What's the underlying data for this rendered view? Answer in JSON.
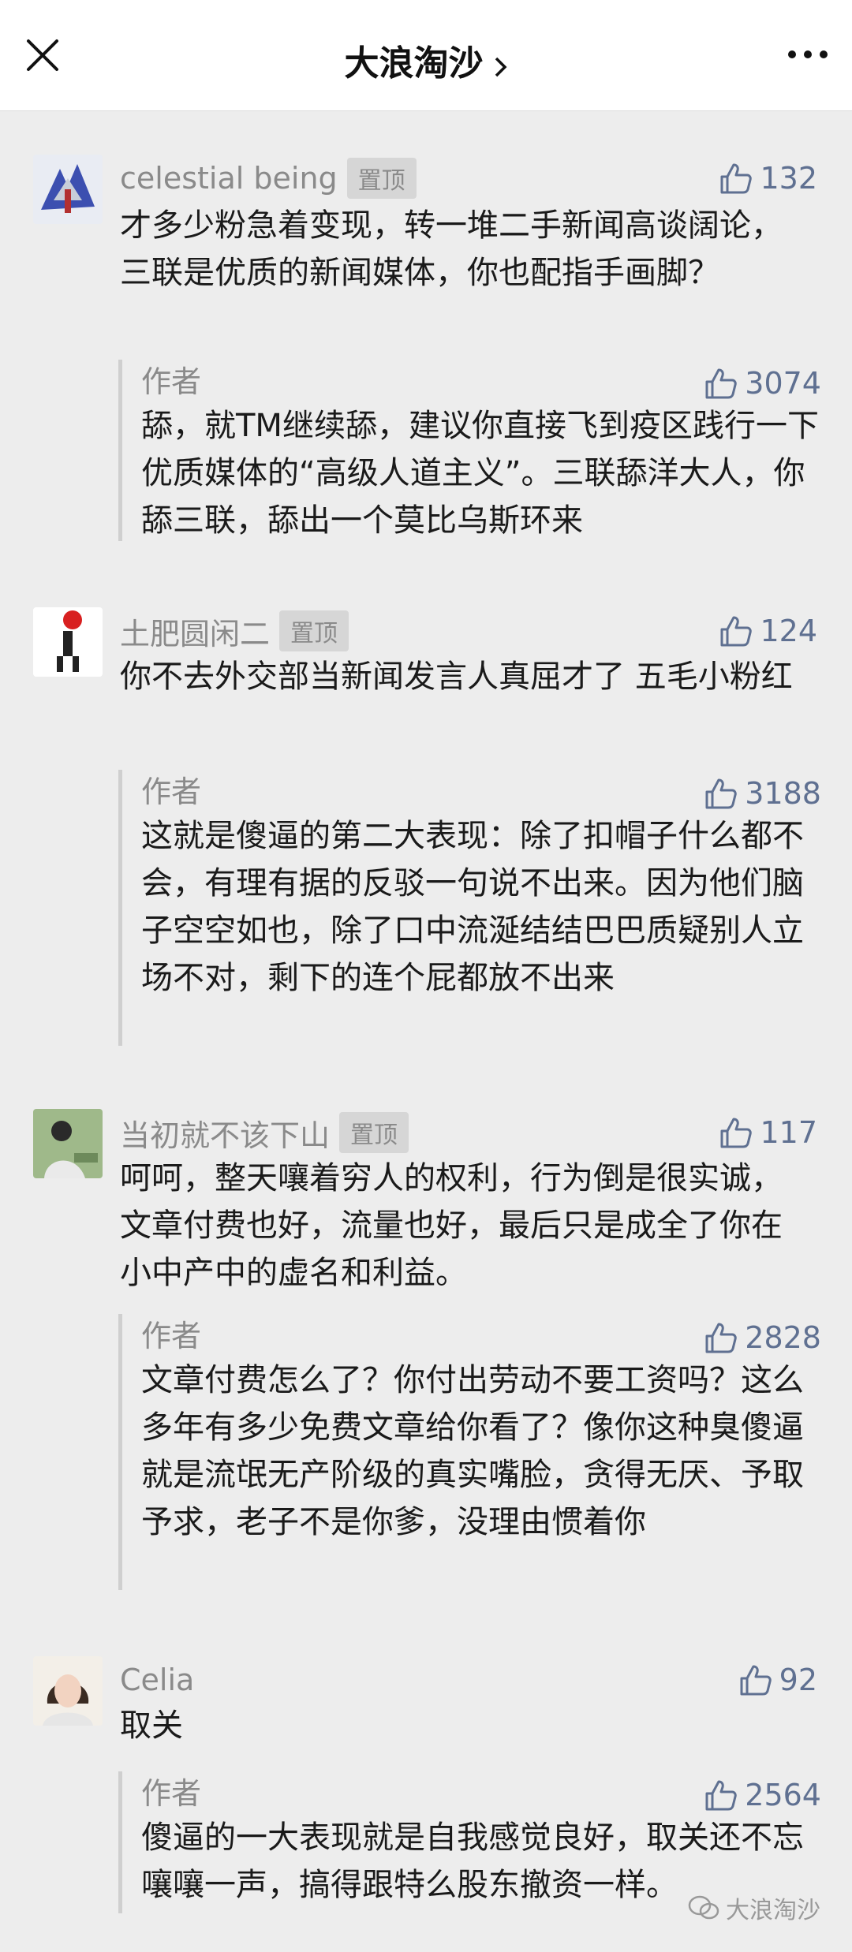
{
  "header": {
    "title": "大浪淘沙"
  },
  "comments": [
    {
      "name": "celestial being",
      "pin": "置顶",
      "likes": "132",
      "text": "才多少粉急着变现，转一堆二手新闻高谈阔论，三联是优质的新闻媒体，你也配指手画脚？",
      "reply": {
        "author": "作者",
        "likes": "3074",
        "text": "舔，就TM继续舔，建议你直接飞到疫区践行一下优质媒体的“高级人道主义”。三联舔洋大人，你舔三联，舔出一个莫比乌斯环来"
      }
    },
    {
      "name": "土肥圆闲二",
      "pin": "置顶",
      "likes": "124",
      "text": "你不去外交部当新闻发言人真屈才了 五毛小粉红",
      "reply": {
        "author": "作者",
        "likes": "3188",
        "text": "这就是傻逼的第二大表现：除了扣帽子什么都不会，有理有据的反驳一句说不出来。因为他们脑子空空如也，除了口中流涎结结巴巴质疑别人立场不对，剩下的连个屁都放不出来"
      }
    },
    {
      "name": "当初就不该下山",
      "pin": "置顶",
      "likes": "117",
      "text": "呵呵，整天嚷着穷人的权利，行为倒是很实诚，文章付费也好，流量也好，最后只是成全了你在小中产中的虚名和利益。",
      "reply": {
        "author": "作者",
        "likes": "2828",
        "text": "文章付费怎么了？你付出劳动不要工资吗？这么多年有多少免费文章给你看了？像你这种臭傻逼就是流氓无产阶级的真实嘴脸，贪得无厌、予取予求，老子不是你爹，没理由惯着你"
      }
    },
    {
      "name": "Celia",
      "pin": "",
      "likes": "92",
      "text": "取关",
      "reply": {
        "author": "作者",
        "likes": "2564",
        "text": "傻逼的一大表现就是自我感觉良好，取关还不忘嚷嚷一声，搞得跟特么股东撤资一样。"
      }
    }
  ],
  "watermark": {
    "text": "大浪淘沙"
  },
  "colors": {
    "accent": "#5f7091",
    "background": "#ededed",
    "muted": "#8a8a8a"
  }
}
